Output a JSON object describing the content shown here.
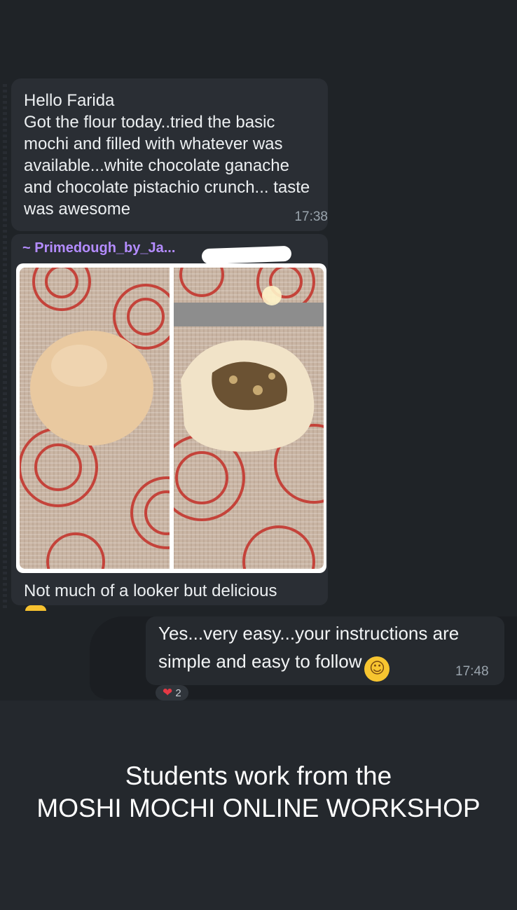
{
  "messages": {
    "incoming_text": "Hello Farida\nGot the flour today..tried the basic mochi and filled with whatever was available...white chocolate ganache and chocolate pistachio crunch... taste was awesome",
    "incoming_time": "17:38",
    "photo_sender": "~ Primedough_by_Ja...",
    "photo_caption": "Not much of a looker but delicious",
    "reply_text": "Yes...very easy...your instructions are simple and easy to follow",
    "reply_emoji": "☺",
    "reply_time": "17:48",
    "reaction_emoji": "❤",
    "reaction_count": "2"
  },
  "story": {
    "line1": "Students work from the",
    "line2": "MOSHI MOCHI ONLINE WORKSHOP"
  },
  "colors": {
    "background": "#24282d",
    "sender_name": "#b48cff",
    "heart": "#e53945"
  }
}
